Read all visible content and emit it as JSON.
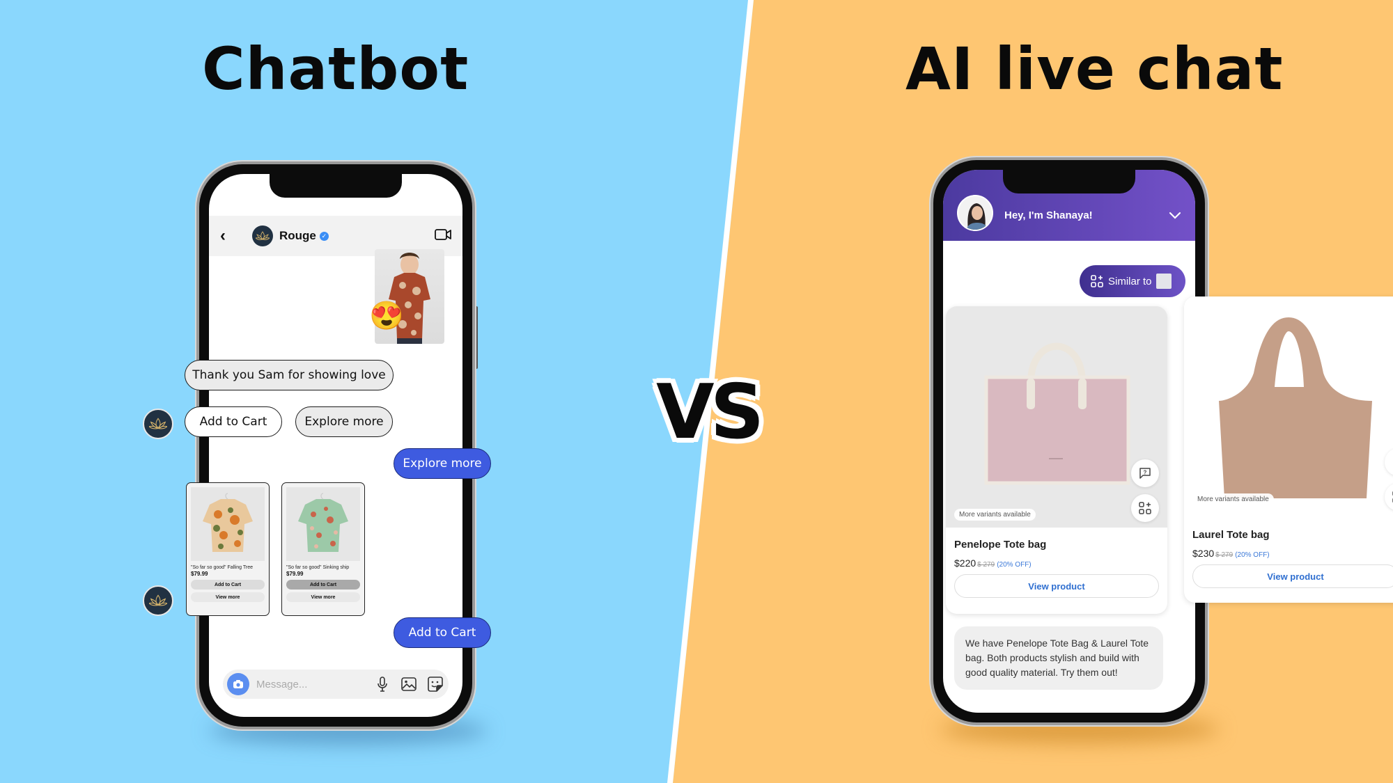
{
  "titles": {
    "left": "Chatbot",
    "right": "AI live chat",
    "vs": "VS"
  },
  "colors": {
    "left_bg": "#8ad7fd",
    "right_bg": "#fec672",
    "chatbot_button": "#3e5be0",
    "ai_header_start": "#4c3aa0",
    "ai_header_end": "#7351c8",
    "link_blue": "#2f6fd0"
  },
  "chatbot": {
    "header": {
      "back_icon": "chevron-left-icon",
      "brand_name": "Rouge",
      "verified_icon": "verified-badge-icon",
      "video_icon": "video-camera-icon"
    },
    "sent_photo_reaction": "😍",
    "bot_message": "Thank you Sam for showing love",
    "quick_replies": [
      "Add to Cart",
      "Explore more"
    ],
    "user_reply_1": "Explore more",
    "products": [
      {
        "name": "\"So far so good\" Falling Tree",
        "price": "$79.99",
        "add_label": "Add to Cart",
        "view_label": "View more"
      },
      {
        "name": "\"So far so good\" Sinking ship",
        "price": "$79.99",
        "add_label": "Add to Cart",
        "view_label": "View more"
      }
    ],
    "user_reply_2": "Add to Cart",
    "composer": {
      "placeholder": "Message...",
      "icons": [
        "camera-icon",
        "microphone-icon",
        "image-icon",
        "sticker-icon"
      ]
    }
  },
  "ai_chat": {
    "header": {
      "greeting": "Hey, I'm Shanaya!",
      "collapse_icon": "chevron-down-icon"
    },
    "similar_button": "Similar to",
    "products": [
      {
        "name": "Penelope Tote bag",
        "price": "$220",
        "old_price": "$ 279",
        "discount": "(20% OFF)",
        "variants": "More variants available",
        "view_label": "View product"
      },
      {
        "name": "Laurel Tote bag",
        "price": "$230",
        "old_price": "$ 279",
        "discount": "(20% OFF)",
        "variants": "More variants available",
        "view_label": "View product"
      }
    ],
    "reply": "We have Penelope Tote Bag & Laurel Tote bag. Both products stylish and build with good quality material. Try them out!"
  }
}
